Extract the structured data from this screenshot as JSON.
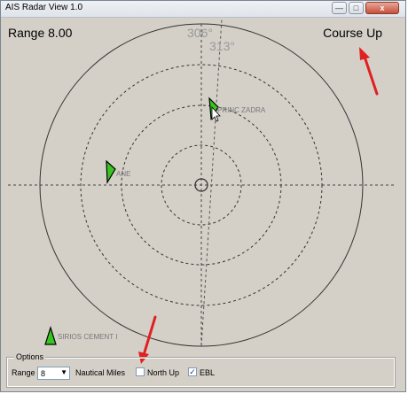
{
  "window": {
    "title": "AIS Radar View 1.0",
    "minimize_symbol": "—",
    "maximize_symbol": "□",
    "close_symbol": "x"
  },
  "radar": {
    "range_text": "Range 8.00",
    "mode_text": "Course Up",
    "heading_label": "306°",
    "bearing_label": "313°",
    "targets": [
      {
        "name": "PRINC ZADRA",
        "color": "#39c422"
      },
      {
        "name": "ANE",
        "color": "#39c422"
      },
      {
        "name": "SIRIOS CEMENT I",
        "color": "#39c422"
      }
    ]
  },
  "options": {
    "legend": "Options",
    "range_label": "Range",
    "range_value": "8",
    "units_label": "Nautical Miles",
    "north_up_label": "North Up",
    "north_up_checked": false,
    "ebl_label": "EBL",
    "ebl_checked": true
  },
  "colors": {
    "background": "#d4d0c8",
    "ring": "#333333",
    "annotation_arrow": "#e02020"
  },
  "icons": [
    "minimize-icon",
    "maximize-icon",
    "close-icon",
    "mouse-cursor-icon",
    "annotation-arrow-icon"
  ]
}
